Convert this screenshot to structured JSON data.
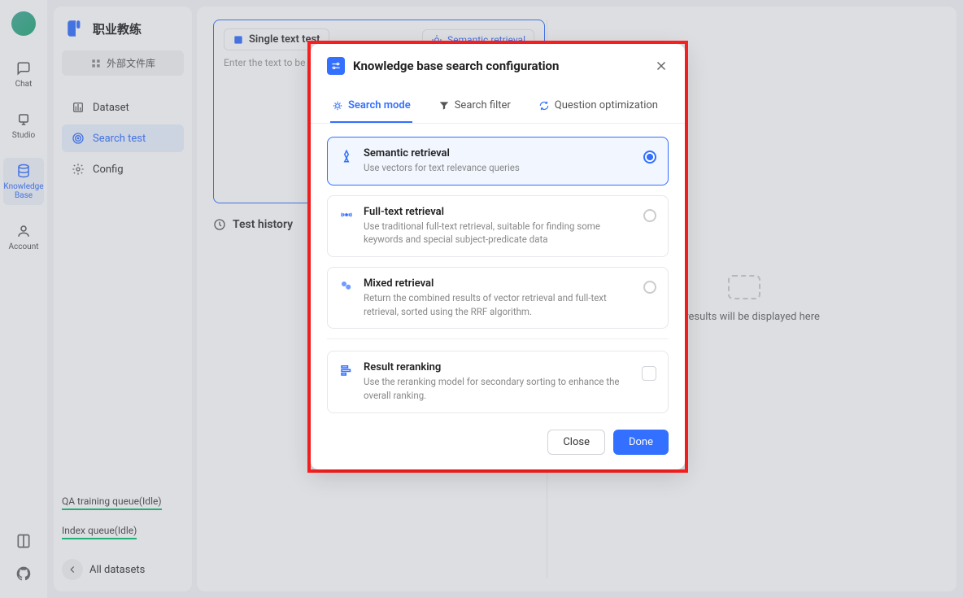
{
  "rail": {
    "items": [
      {
        "label": "Chat"
      },
      {
        "label": "Studio"
      },
      {
        "label": "Knowledge Base"
      },
      {
        "label": "Account"
      }
    ]
  },
  "side": {
    "title": "职业教练",
    "ext_lib": "外部文件库",
    "nav": [
      {
        "label": "Dataset"
      },
      {
        "label": "Search test"
      },
      {
        "label": "Config"
      }
    ],
    "queues": [
      {
        "label": "QA training queue(Idle)"
      },
      {
        "label": "Index queue(Idle)"
      }
    ],
    "all": "All datasets"
  },
  "test": {
    "single": "Single text test",
    "sem": "Semantic retrieval",
    "placeholder": "Enter the text to be te",
    "history": "Test history",
    "results_placeholder": "est results will be displayed here"
  },
  "modal": {
    "title": "Knowledge base search configuration",
    "tabs": [
      {
        "label": "Search mode"
      },
      {
        "label": "Search filter"
      },
      {
        "label": "Question optimization"
      }
    ],
    "opts": [
      {
        "title": "Semantic retrieval",
        "desc": "Use vectors for text relevance queries"
      },
      {
        "title": "Full-text retrieval",
        "desc": "Use traditional full-text retrieval, suitable for finding some keywords and special subject-predicate data"
      },
      {
        "title": "Mixed retrieval",
        "desc": "Return the combined results of vector retrieval and full-text retrieval, sorted using the RRF algorithm."
      }
    ],
    "rerank": {
      "title": "Result reranking",
      "desc": "Use the reranking model for secondary sorting to enhance the overall ranking."
    },
    "close": "Close",
    "done": "Done"
  }
}
